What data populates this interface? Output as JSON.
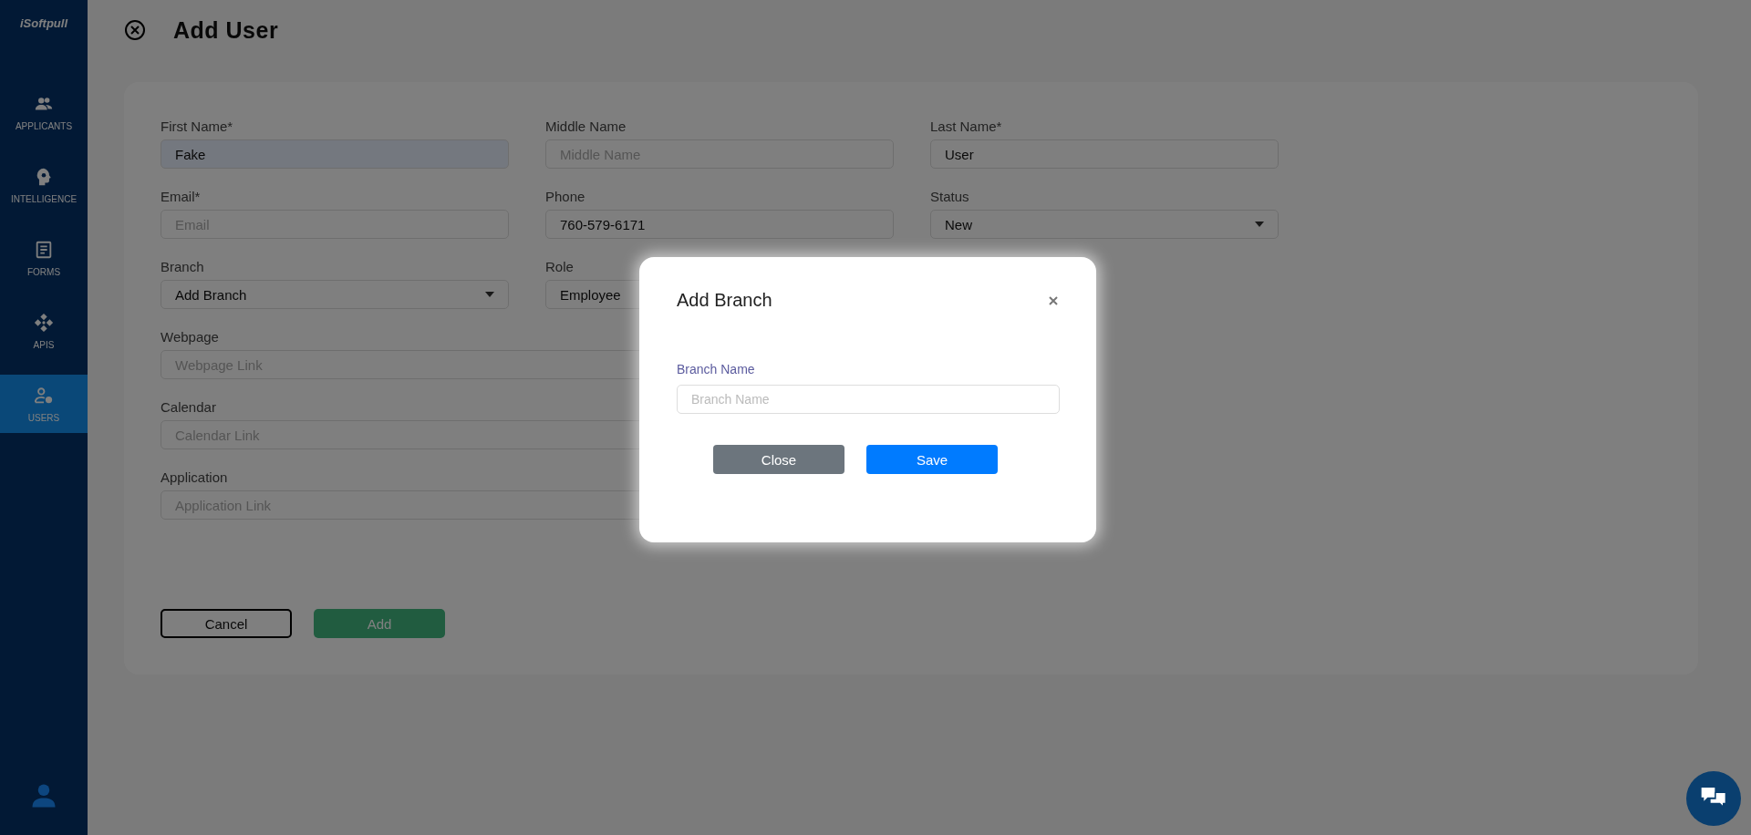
{
  "sidebar": {
    "logo": "iSoftpull",
    "items": [
      {
        "label": "APPLICANTS",
        "selected": false
      },
      {
        "label": "INTELLIGENCE",
        "selected": false
      },
      {
        "label": "FORMS",
        "selected": false
      },
      {
        "label": "APIS",
        "selected": false
      },
      {
        "label": "USERS",
        "selected": true
      }
    ]
  },
  "page": {
    "title": "Add User"
  },
  "form": {
    "fields": [
      {
        "label": "First Name*",
        "kind": "text",
        "value": "Fake",
        "autofilled": true
      },
      {
        "label": "Middle Name",
        "kind": "text",
        "placeholder": "Middle Name",
        "autofilled": false
      },
      {
        "label": "Last Name*",
        "kind": "text",
        "value": "User",
        "autofilled": false
      },
      {
        "label": "Email*",
        "kind": "text",
        "placeholder": "Email",
        "autofilled": false
      },
      {
        "label": "Phone",
        "kind": "text",
        "value": "760-579-6171",
        "autofilled": false
      },
      {
        "label": "Status",
        "kind": "select",
        "value": "New"
      },
      {
        "label": "Branch",
        "kind": "select",
        "value": "Add Branch"
      },
      {
        "label": "Role",
        "kind": "select",
        "value": "Employee"
      },
      {
        "label": "Webpage",
        "kind": "link",
        "placeholder": "Webpage Link",
        "autofilled": false
      },
      {
        "label": "Calendar",
        "kind": "link",
        "placeholder": "Calendar Link",
        "autofilled": false
      },
      {
        "label": "Application",
        "kind": "link",
        "placeholder": "Application Link",
        "autofilled": false
      }
    ],
    "buttons": [
      {
        "label": "Cancel",
        "kind": "outline"
      },
      {
        "label": "Add",
        "kind": "primary"
      }
    ]
  },
  "modal": {
    "title": "Add Branch",
    "field": {
      "label": "Branch Name",
      "placeholder": "Branch Name"
    },
    "buttons": [
      {
        "label": "Close",
        "kind": "secondary"
      },
      {
        "label": "Save",
        "kind": "primary"
      }
    ]
  }
}
